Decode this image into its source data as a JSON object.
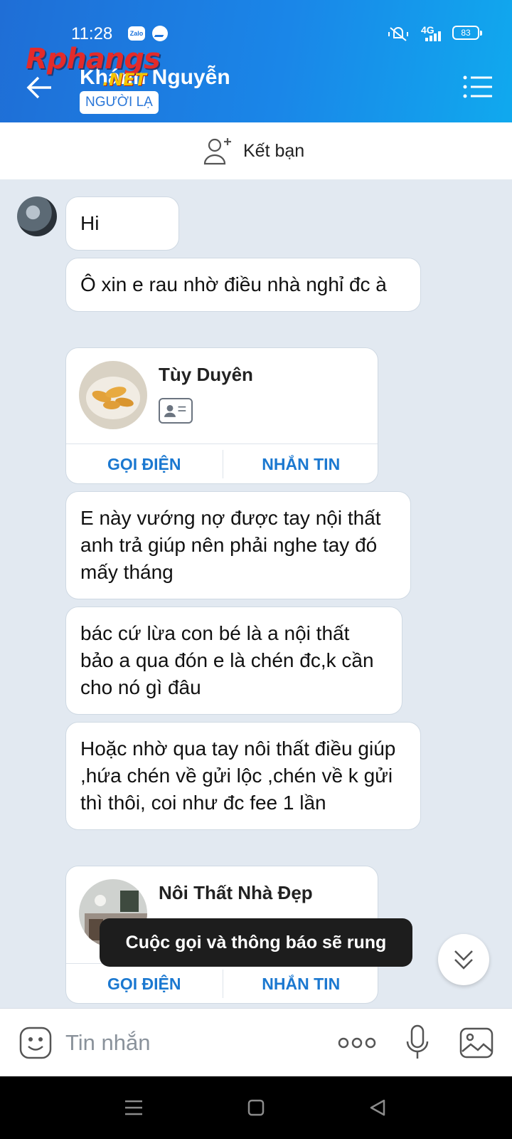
{
  "status_bar": {
    "time": "11:28",
    "network": "4G",
    "battery": "83",
    "app_icon_zalo": "Zalo"
  },
  "header": {
    "contact_name": "Khánh Nguyễn",
    "badge": "NGƯỜI LẠ"
  },
  "watermark": {
    "top": "Rphangs",
    "bottom": ".NET"
  },
  "friend_bar": {
    "label": "Kết bạn"
  },
  "messages": [
    {
      "type": "text",
      "text": "Hi"
    },
    {
      "type": "text",
      "text": "Ô xin e rau nhờ điều nhà nghỉ đc à"
    },
    {
      "type": "contact_card",
      "name": "Tùy Duyên",
      "call_label": "GỌI ĐIỆN",
      "message_label": "NHẮN TIN"
    },
    {
      "type": "text",
      "text": "E này vướng nợ được tay nội thất anh trả giúp nên phải nghe tay đó mấy tháng"
    },
    {
      "type": "text",
      "text": "bác cứ lừa con bé là a nội thất bảo a qua đón e là chén đc,k cần cho nó gì đâu"
    },
    {
      "type": "text",
      "text": "Hoặc nhờ qua tay nôi thất điều giúp ,hứa chén về gửi lộc ,chén về k gửi thì thôi, coi như đc fee 1 lần"
    },
    {
      "type": "contact_card",
      "name": "Nôi Thất Nhà Đẹp",
      "call_label": "GỌI ĐIỆN",
      "message_label": "NHẮN TIN"
    }
  ],
  "toast": "Cuộc gọi và thông báo sẽ rung",
  "composer": {
    "placeholder": "Tin nhắn"
  },
  "icons": [
    "back-arrow-icon",
    "menu-list-icon",
    "add-friend-icon",
    "id-card-icon",
    "chevrons-down-icon",
    "emoji-icon",
    "more-dots-icon",
    "microphone-icon",
    "image-icon",
    "nav-menu-icon",
    "nav-home-icon",
    "nav-back-icon"
  ],
  "colors": {
    "header_start": "#1f6ed6",
    "header_end": "#10a9ee",
    "accent": "#1b78d0",
    "chat_bg": "#e2e9f1"
  }
}
